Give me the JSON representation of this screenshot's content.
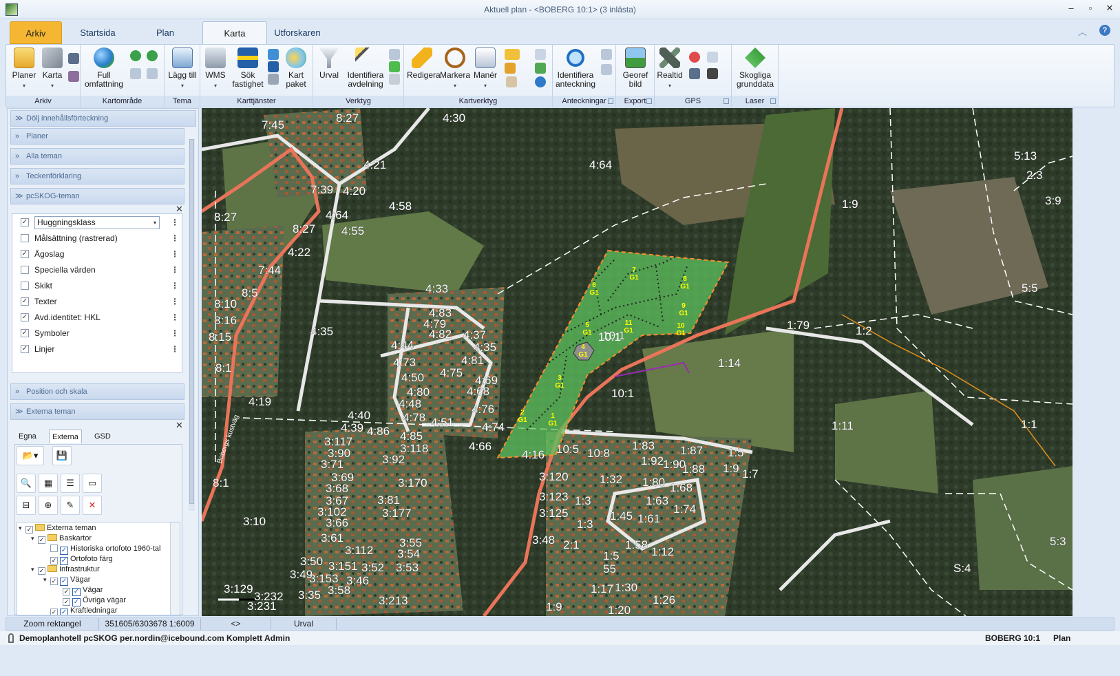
{
  "window": {
    "title": "Aktuell plan -  <BOBERG 10:1> (3 inlästa)",
    "controls": [
      "–",
      "▫",
      "✕"
    ]
  },
  "tabs": [
    {
      "label": "Arkiv"
    },
    {
      "label": "Startsida"
    },
    {
      "label": "Plan"
    },
    {
      "label": "Karta"
    },
    {
      "label": "Utforskaren"
    }
  ],
  "ribbon": {
    "groups": [
      {
        "label": "Arkiv",
        "buttons": [
          "Planer",
          "Karta"
        ]
      },
      {
        "label": "Kartområde",
        "buttons": [
          "Full omfattning"
        ]
      },
      {
        "label": "Tema",
        "buttons": [
          "Lägg till"
        ]
      },
      {
        "label": "Karttjänster",
        "buttons": [
          "WMS",
          "Sök fastighet",
          "Kart paket"
        ]
      },
      {
        "label": "Verktyg",
        "buttons": [
          "Urval",
          "Identifiera avdelning"
        ]
      },
      {
        "label": "Kartverktyg",
        "buttons": [
          "Redigera",
          "Markera",
          "Manér"
        ]
      },
      {
        "label": "Anteckningar",
        "buttons": [
          "Identifiera anteckning"
        ]
      },
      {
        "label": "Export",
        "buttons": [
          "Georef bild"
        ]
      },
      {
        "label": "GPS",
        "buttons": [
          "Realtid"
        ]
      },
      {
        "label": "Laser",
        "buttons": [
          "Skogliga grunddata"
        ]
      }
    ]
  },
  "left_panel": {
    "toggle_label": "Dölj innehållsförteckning",
    "sections": {
      "planer": "Planer",
      "alla_teman": "Alla teman",
      "teckenforklaring": "Teckenförklaring",
      "pcskog_teman": "pcSKOG-teman",
      "position": "Position och skala",
      "externa": "Externa teman"
    },
    "themes": [
      {
        "label": "Huggningsklass",
        "checked": true
      },
      {
        "label": "Målsättning (rastrerad)",
        "checked": false
      },
      {
        "label": "Ägoslag",
        "checked": true
      },
      {
        "label": "Speciella värden",
        "checked": false
      },
      {
        "label": "Skikt",
        "checked": false
      },
      {
        "label": "Texter",
        "checked": true
      },
      {
        "label": "Avd.identitet: HKL",
        "checked": true
      },
      {
        "label": "Symboler",
        "checked": true
      },
      {
        "label": "Linjer",
        "checked": true
      }
    ],
    "ext_tabs": [
      "Egna",
      "Externa",
      "GSD"
    ],
    "tree": [
      {
        "label": "Externa teman",
        "level": 0
      },
      {
        "label": "Baskartor",
        "level": 1
      },
      {
        "label": "Historiska ortofoto 1960-tal",
        "level": 2
      },
      {
        "label": "Ortofoto färg",
        "level": 2
      },
      {
        "label": "Infrastruktur",
        "level": 1
      },
      {
        "label": "Vägar",
        "level": 2
      },
      {
        "label": "Vägar",
        "level": 3
      },
      {
        "label": "Övriga vägar",
        "level": 3
      },
      {
        "label": "Kraftledningar",
        "level": 2
      }
    ]
  },
  "map": {
    "labels": [
      "7:45",
      "8:27",
      "4:30",
      "4:21",
      "4:64",
      "7:39",
      "4:20",
      "4:58",
      "8:27",
      "8:27",
      "4:64",
      "4:55",
      "4:22",
      "7:44",
      "8:5",
      "8:10",
      "8:16",
      "8:15",
      "8:1",
      "4:35",
      "4:33",
      "4:83",
      "4:79",
      "4:82",
      "4:37",
      "4:44",
      "4:35",
      "4:73",
      "4:81",
      "4:75",
      "4:50",
      "4:69",
      "4:80",
      "4:68",
      "4:48",
      "4:76",
      "4:78",
      "4:51",
      "4:19",
      "4:40",
      "4:39",
      "4:86",
      "4:85",
      "4:74",
      "3:117",
      "3:118",
      "3:90",
      "3:92",
      "3:71",
      "4:66",
      "4:16",
      "10:5",
      "10:8",
      "3:69",
      "3:68",
      "3:170",
      "3:67",
      "3:81",
      "3:102",
      "3:177",
      "3:66",
      "3:10",
      "3:61",
      "3:55",
      "3:112",
      "3:54",
      "3:50",
      "3:151",
      "3:52",
      "3:53",
      "3:49",
      "3:153",
      "3:46",
      "3:129",
      "3:58",
      "3:232",
      "3:35",
      "3:213",
      "3:231",
      "8:1",
      "10:1",
      "10:1",
      "1:14",
      "1:79",
      "1:2",
      "1:9",
      "5:13",
      "2:3",
      "3:9",
      "5:5",
      "1:11",
      "1:1",
      "1:83",
      "1:87",
      "1:5",
      "1:92",
      "1:90",
      "1:88",
      "1:9",
      "1:7",
      "3:120",
      "1:32",
      "1:80",
      "1:68",
      "3:123",
      "1:3",
      "1:63",
      "1:74",
      "3:125",
      "1:45",
      "1:61",
      "3:48",
      "1:3",
      "2:1",
      "1:58",
      "1:12",
      "1:5",
      "55",
      "1:17",
      "1:30",
      "1:26",
      "1:9",
      "1:20",
      "5:3",
      "S:4"
    ],
    "stand_ids": [
      "1",
      "2",
      "3",
      "4",
      "5",
      "6",
      "7",
      "8",
      "9",
      "10",
      "11"
    ],
    "stand_class": "G1",
    "center_label": "10:1",
    "road_name": "Bobergs kustväg"
  },
  "status": {
    "tool": "Zoom rektangel",
    "coords": "351605/6303678 1:6009",
    "arrows": "<>",
    "mode": "Urval"
  },
  "footer": {
    "user": "Demoplanhotell pcSKOG per.nordin@icebound.com Komplett Admin",
    "property": "BOBERG 10:1",
    "view": "Plan"
  }
}
